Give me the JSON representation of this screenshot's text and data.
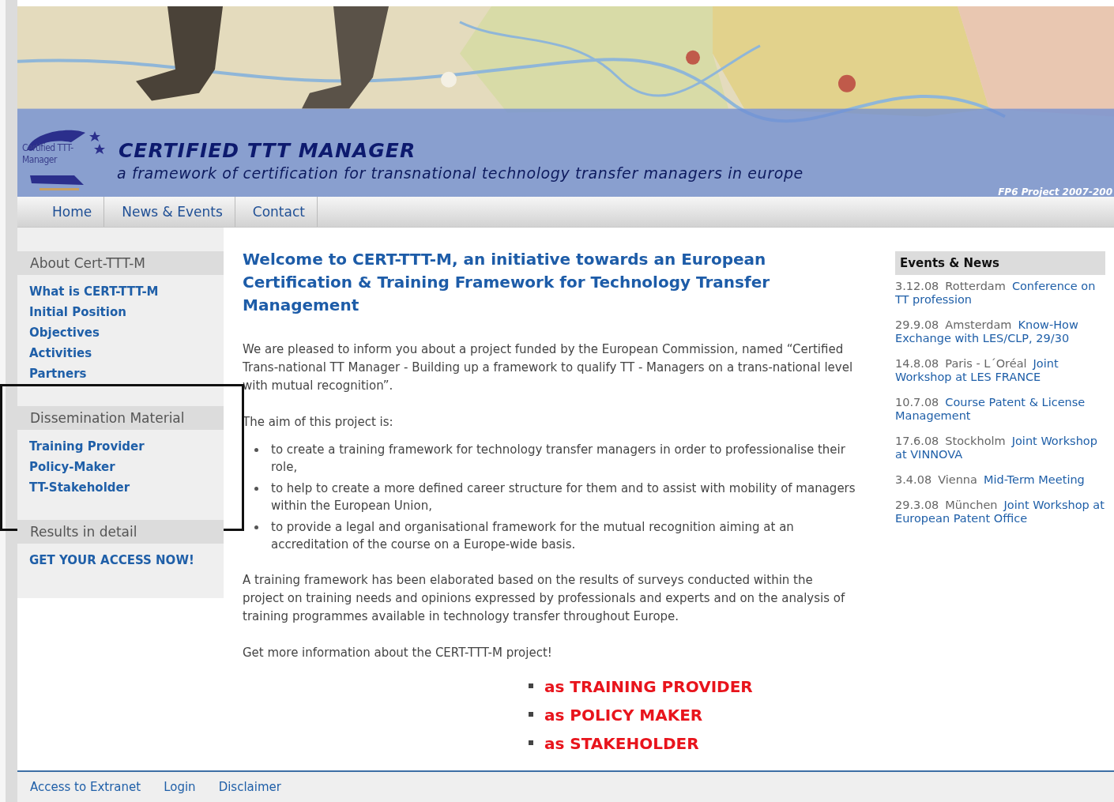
{
  "header": {
    "logo_text": "Certified TTT-Manager",
    "title": "CERTIFIED TTT MANAGER",
    "tagline": "a framework of certification for transnational technology transfer managers in europe",
    "project": "FP6 Project 2007-200"
  },
  "nav": [
    {
      "label": "Home"
    },
    {
      "label": "News & Events"
    },
    {
      "label": "Contact"
    }
  ],
  "sidebar": [
    {
      "heading": "About Cert-TTT-M",
      "highlighted": false,
      "links": [
        "What is CERT-TTT-M",
        "Initial Position",
        "Objectives",
        "Activities",
        "Partners"
      ]
    },
    {
      "heading": "Dissemination Material",
      "highlighted": true,
      "links": [
        "Training Provider",
        "Policy-Maker",
        "TT-Stakeholder"
      ]
    },
    {
      "heading": "Results in detail",
      "highlighted": false,
      "links": [
        "GET YOUR ACCESS NOW!"
      ]
    }
  ],
  "main": {
    "title": "Welcome to CERT-TTT-M, an initiative towards an European Certification & Training Framework for Technology Transfer Management",
    "intro": "We are pleased to inform you about a project funded by the European Commission, named “Certified Trans-national TT Manager - Building up a framework to qualify TT - Managers on a trans-national level with mutual recognition”.",
    "aim_label": "The aim of this project is:",
    "aims": [
      "to create a training framework for technology transfer managers in order to professionalise their role,",
      "to help to create a more defined career structure for them and to assist with mobility of managers within the European Union,",
      "to provide a legal and organisational framework for the mutual recognition aiming at an accreditation of the course on a Europe-wide basis."
    ],
    "summary": "A training framework has been elaborated based on the results of surveys conducted within the project on training needs and opinions expressed by professionals and experts and on the analysis of training programmes available in technology transfer throughout Europe.",
    "more_info": "Get more information about the CERT-TTT-M project!",
    "audience_links": [
      "as TRAINING PROVIDER",
      "as POLICY MAKER",
      "as STAKEHOLDER"
    ]
  },
  "events": {
    "heading": "Events & News",
    "items": [
      {
        "date": "3.12.08",
        "place": "Rotterdam",
        "title": "Conference on TT profession"
      },
      {
        "date": "29.9.08",
        "place": "Amsterdam",
        "title": "Know-How Exchange with LES/CLP, 29/30"
      },
      {
        "date": "14.8.08",
        "place": "Paris - L´Oréal",
        "title": "Joint Workshop at LES FRANCE"
      },
      {
        "date": "10.7.08",
        "title": "Course Patent & License Management"
      },
      {
        "date": "17.6.08",
        "place": "Stockholm",
        "title": "Joint Workshop at VINNOVA"
      },
      {
        "date": "3.4.08",
        "place": "Vienna",
        "title": "Mid-Term Meeting"
      },
      {
        "date": "29.3.08",
        "place": "München",
        "title": "Joint Workshop at European Patent Office"
      }
    ]
  },
  "footer": [
    "Access to Extranet",
    "Login",
    "Disclaimer"
  ]
}
